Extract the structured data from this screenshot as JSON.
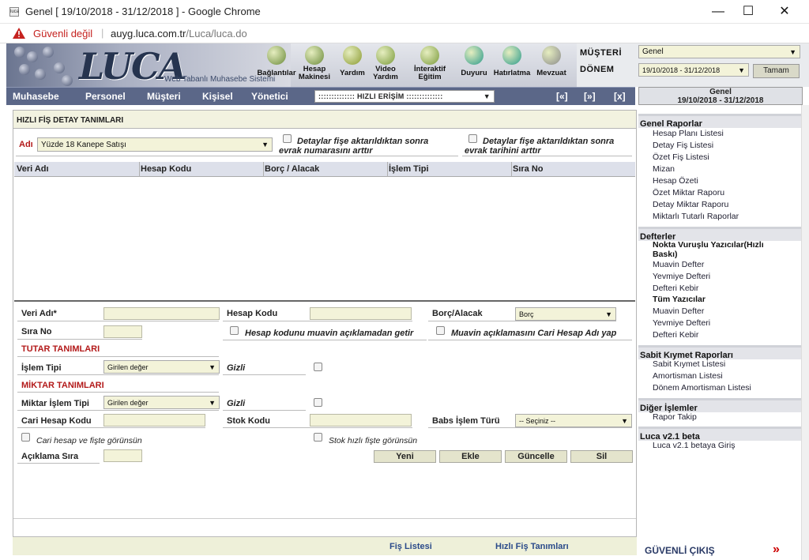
{
  "window": {
    "title": "Genel [ 19/10/2018 - 31/12/2018 ] - Google Chrome",
    "favicon": "luca",
    "minimize": "—",
    "maximize": "☐",
    "close": "✕"
  },
  "addressbar": {
    "security": "Güvenli değil",
    "separator": "|",
    "url_host": "auyg.luca.com.tr",
    "url_path": "/Luca/luca.do"
  },
  "header": {
    "logo": "LUCA",
    "logo_sub": "Web Tabanlı Muhasebe Sistemi",
    "toolbar": [
      {
        "label1": "Bağlantılar",
        "label2": "",
        "icon": "network-icon",
        "color": "#6a8a3a"
      },
      {
        "label1": "Hesap",
        "label2": "Makinesi",
        "icon": "calculator-icon",
        "color": "#6a8a3a"
      },
      {
        "label1": "Yardım",
        "label2": "",
        "icon": "help-icon",
        "color": "#8a9a30"
      },
      {
        "label1": "Video",
        "label2": "Yardım",
        "icon": "video-icon",
        "color": "#7a9a3a"
      },
      {
        "label1": "İnteraktif",
        "label2": "Eğitim",
        "icon": "chat-icon",
        "color": "#7a9a3a"
      },
      {
        "label1": "Duyuru",
        "label2": "",
        "icon": "people-icon",
        "color": "#2a9a8a"
      },
      {
        "label1": "Hatırlatma",
        "label2": "",
        "icon": "reminder-icon",
        "color": "#2a9a8a"
      },
      {
        "label1": "Mevzuat",
        "label2": "",
        "icon": "document-icon",
        "color": "#8a8a8a"
      }
    ],
    "musteri_label": "MÜŞTERİ",
    "musteri_value": "Genel",
    "donem_label": "DÖNEM",
    "donem_value": "19/10/2018 - 31/12/2018",
    "tamam": "Tamam",
    "select_arrow": "▼"
  },
  "menu": {
    "items": [
      "Muhasebe",
      "Personel",
      "Müşteri",
      "Kişisel",
      "Yönetici"
    ],
    "hizli": ":::::::::::::: HIZLI ERİŞİM ::::::::::::::",
    "nav": [
      "[«]",
      "[»]",
      "[x]"
    ],
    "genel_title": "Genel",
    "genel_dates": "19/10/2018 - 31/12/2018"
  },
  "form": {
    "title": "HIZLI FİŞ DETAY TANIMLARI",
    "adi_label": "Adı",
    "adi_value": "Yüzde 18 Kanepe Satışı",
    "chk1_line1": "Detaylar fişe aktarıldıktan sonra",
    "chk1_line2": "evrak numarasını arttır",
    "chk2_line1": "Detaylar fişe aktarıldıktan sonra",
    "chk2_line2": "evrak tarihini arttır",
    "grid_columns": [
      "Veri Adı",
      "Hesap Kodu",
      "Borç / Alacak",
      "İşlem Tipi",
      "Sıra No"
    ],
    "veri_adi": "Veri Adı*",
    "hesap_kodu": "Hesap Kodu",
    "borc_alacak": "Borç/Alacak",
    "borc_value": "Borç",
    "sira_no": "Sıra No",
    "muavin_chk": "Hesap kodunu muavin açıklamadan getir",
    "cari_chk": "Muavin açıklamasını Cari Hesap Adı yap",
    "tutar_title": "TUTAR TANIMLARI",
    "islem_tipi": "İşlem Tipi",
    "islem_value": "Girilen değer",
    "gizli": "Gizli",
    "miktar_title": "MİKTAR TANIMLARI",
    "miktar_islem": "Miktar İşlem Tipi",
    "miktar_value": "Girilen değer",
    "gizli2": "Gizli",
    "cari_hesap_kodu": "Cari Hesap Kodu",
    "stok_kodu": "Stok Kodu",
    "babs": "Babs İşlem Türü",
    "babs_value": "-- Seçiniz --",
    "cari_gorunsun": "Cari hesap ve fişte görünsün",
    "stok_gorunsun": "Stok hızlı fişte görünsün",
    "aciklama_sira": "Açıklama Sıra",
    "buttons": [
      "Yeni",
      "Ekle",
      "Güncelle",
      "Sil"
    ]
  },
  "footer": {
    "fis_listesi": "Fiş Listesi",
    "hizli_fis": "Hızlı Fiş Tanımları"
  },
  "sidebar": {
    "genel_raporlar": "Genel Raporlar",
    "genel_items": [
      "Hesap Planı Listesi",
      "Detay Fiş Listesi",
      "Özet Fiş Listesi",
      "Mizan",
      "Hesap Özeti",
      "Özet Miktar Raporu",
      "Detay Miktar Raporu",
      "Miktarlı Tutarlı Raporlar"
    ],
    "defterler": "Defterler",
    "nokta_vuruslu_1": "Nokta Vuruşlu Yazıcılar(Hızlı",
    "nokta_vuruslu_2": "Baskı)",
    "nokta_items": [
      "Muavin Defter",
      "Yevmiye Defteri",
      "Defteri Kebir"
    ],
    "tum_yazicilar": "Tüm Yazıcılar",
    "tum_items": [
      "Muavin Defter",
      "Yevmiye Defteri",
      "Defteri Kebir"
    ],
    "sabit_kiymet": "Sabit Kıymet Raporları",
    "sabit_items": [
      "Sabit Kıymet Listesi",
      "Amortisman Listesi",
      "Dönem Amortisman Listesi"
    ],
    "diger": "Diğer İşlemler",
    "diger_items": [
      "Rapor Takip"
    ],
    "luca_beta": "Luca v2.1 beta",
    "beta_items": [
      "Luca v2.1 betaya Giriş"
    ],
    "guvenli_cikis": "GÜVENLİ ÇIKIŞ",
    "guvenli_arrow": "»"
  }
}
